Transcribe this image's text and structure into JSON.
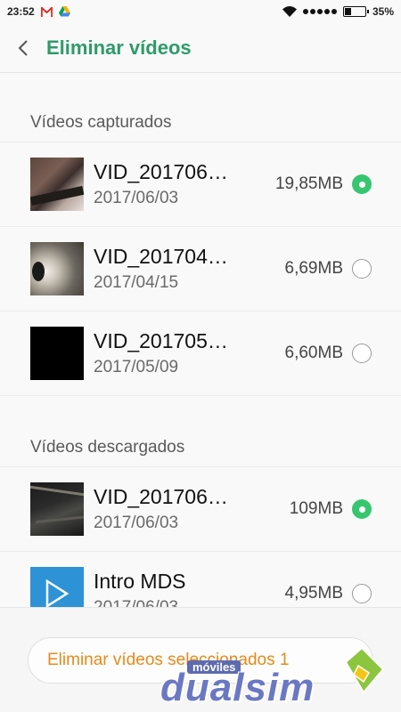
{
  "status_bar": {
    "time": "23:52",
    "battery_percent": "35%",
    "battery_level": 0.35,
    "icons": [
      "gmail-icon",
      "drive-icon",
      "wifi-icon",
      "signal-icon",
      "battery-icon"
    ]
  },
  "header": {
    "back_icon": "chevron-left-icon",
    "title": "Eliminar vídeos"
  },
  "sections": [
    {
      "title": "Vídeos capturados",
      "items": [
        {
          "name": "VID_201706…",
          "date": "2017/06/03",
          "size": "19,85MB",
          "selected": true
        },
        {
          "name": "VID_201704…",
          "date": "2017/04/15",
          "size": "6,69MB",
          "selected": false
        },
        {
          "name": "VID_201705…",
          "date": "2017/05/09",
          "size": "6,60MB",
          "selected": false
        }
      ]
    },
    {
      "title": "Vídeos descargados",
      "items": [
        {
          "name": "VID_201706…",
          "date": "2017/06/03",
          "size": "109MB",
          "selected": true
        },
        {
          "name": "Intro MDS",
          "date": "2017/06/03",
          "size": "4,95MB",
          "selected": false
        }
      ]
    }
  ],
  "bottom": {
    "delete_label": "Eliminar vídeos seleccionados 1"
  },
  "watermark": {
    "small": "móviles",
    "brand": "dualsim"
  },
  "colors": {
    "accent": "#2e9b6a",
    "radio_checked": "#37c66f",
    "delete_text": "#e68a1a"
  }
}
